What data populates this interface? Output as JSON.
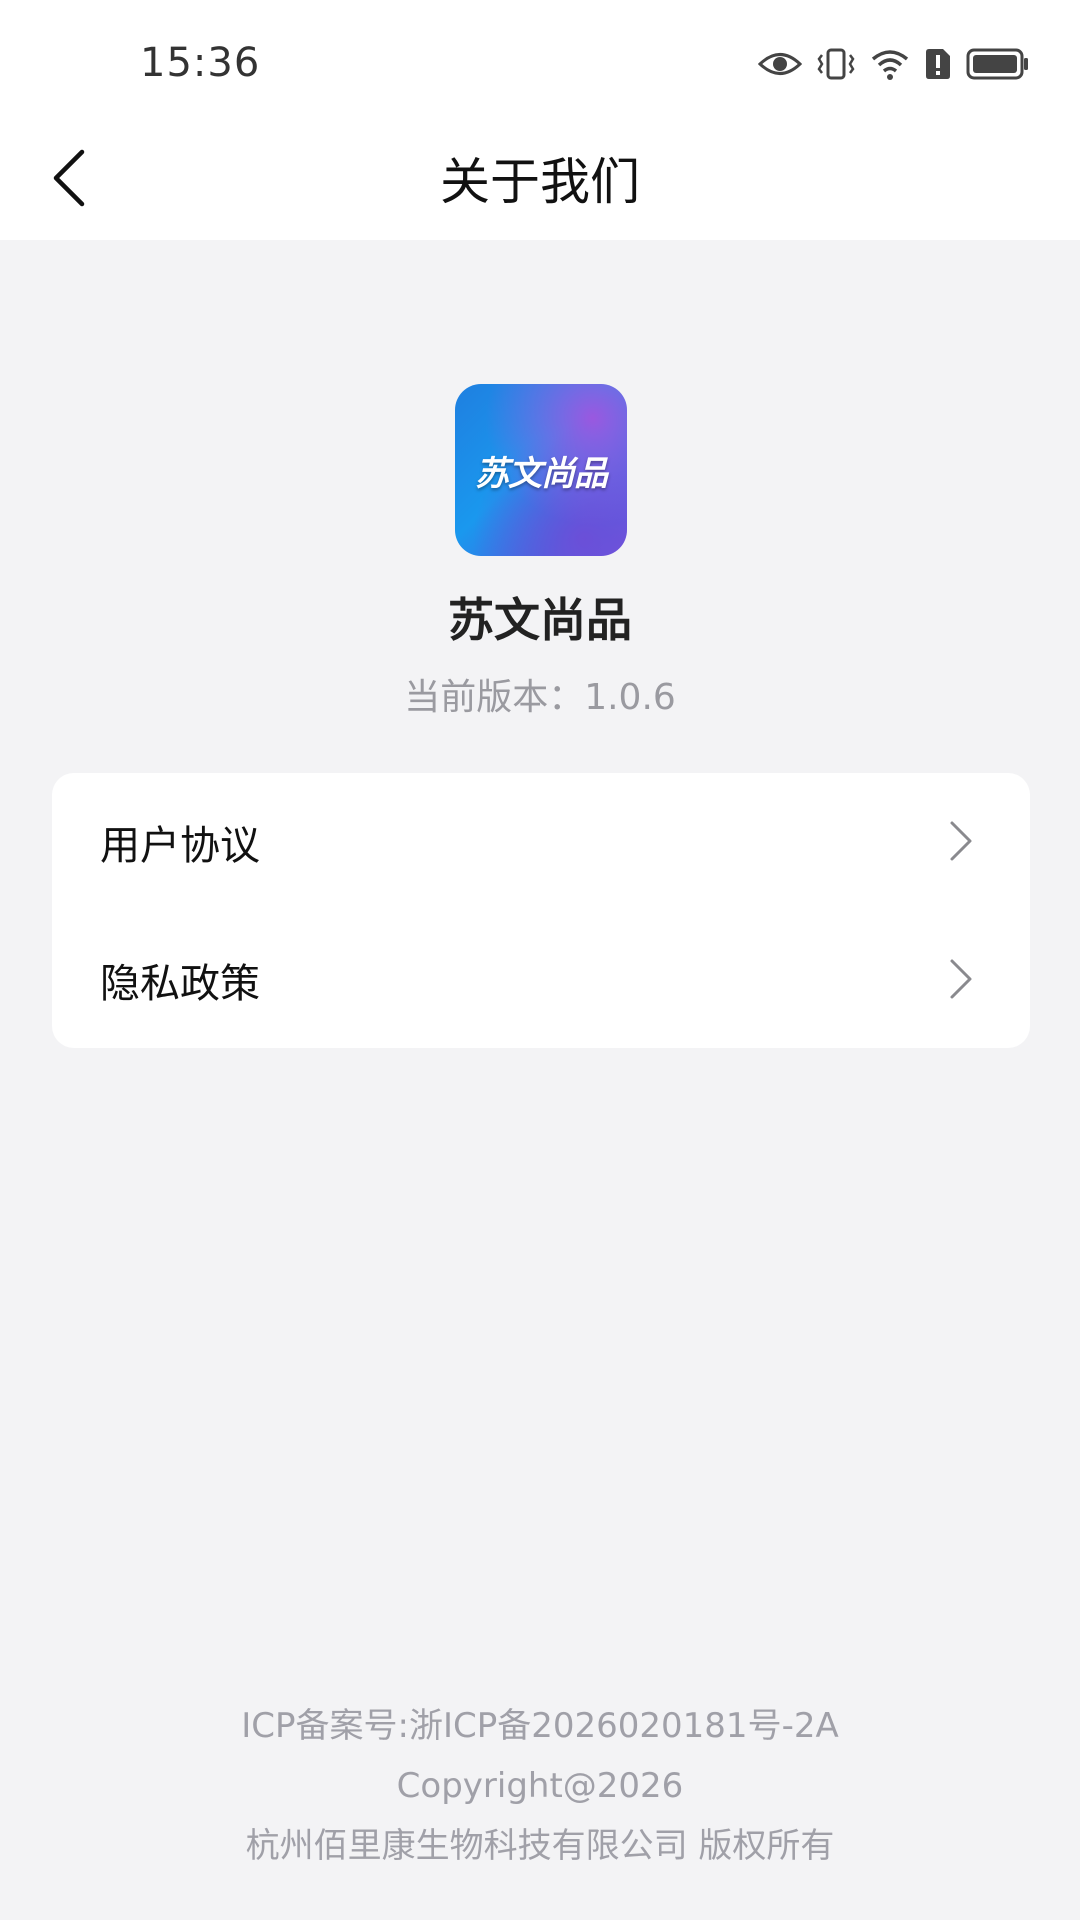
{
  "status_bar": {
    "time": "15:36",
    "icons": [
      "eye-icon",
      "vibrate-icon",
      "wifi-icon",
      "sim-alert-icon",
      "battery-icon"
    ]
  },
  "header": {
    "back_icon": "chevron-left-icon",
    "title": "关于我们"
  },
  "app": {
    "logo_text": "苏文尚品",
    "name": "苏文尚品",
    "version": "当前版本：1.0.6"
  },
  "menu": {
    "items": [
      {
        "label": "用户协议",
        "icon": "chevron-right-icon"
      },
      {
        "label": "隐私政策",
        "icon": "chevron-right-icon"
      }
    ]
  },
  "footer": {
    "icp": "ICP备案号:浙ICP备2026020181号-2A",
    "copyright": "Copyright@2026",
    "company": "杭州佰里康生物科技有限公司 版权所有"
  },
  "colors": {
    "background": "#f3f3f5",
    "card": "#ffffff",
    "muted_text": "#9a9aa0"
  }
}
